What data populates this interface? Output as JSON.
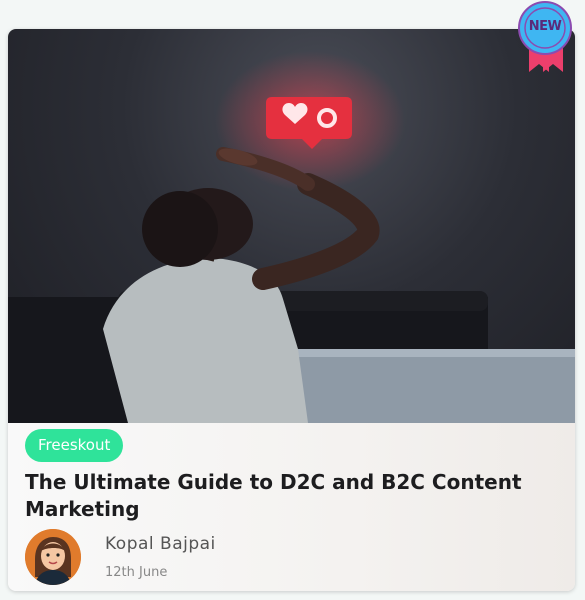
{
  "badge": {
    "text": "NEW"
  },
  "post": {
    "category": "Freeskout",
    "title": "The Ultimate Guide to D2C and B2C Content Marketing",
    "author": "Kopal Bajpai",
    "date": "12th June"
  },
  "colors": {
    "tag": "#2fe39a",
    "badge_blue": "#3fb6f2",
    "ribbon": "#ec3f6c",
    "avatar_bg": "#e07b2c"
  }
}
